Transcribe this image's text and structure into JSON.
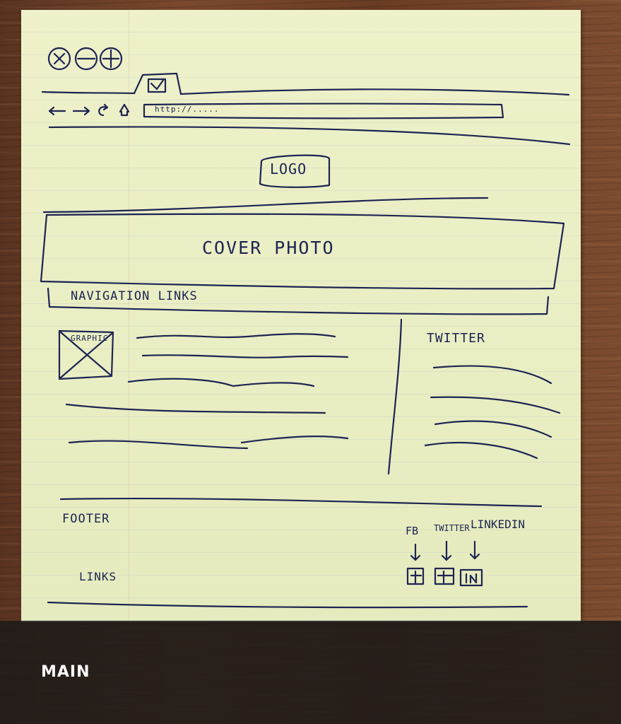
{
  "sketch": {
    "browser": {
      "url_text": "http://....."
    },
    "logo_label": "LOGO",
    "cover_label": "COVER PHOTO",
    "nav_label": "NAVIGATION LINKS",
    "graphic_label": "GRAPHIC",
    "twitter_label": "TWITTER",
    "footer_label": "FOOTER",
    "links_label": "LINKS",
    "social": {
      "fb": "FB",
      "twitter": "TWITTER",
      "linkedin": "LINKEDIN"
    }
  },
  "caption": {
    "label": "MAIN"
  }
}
